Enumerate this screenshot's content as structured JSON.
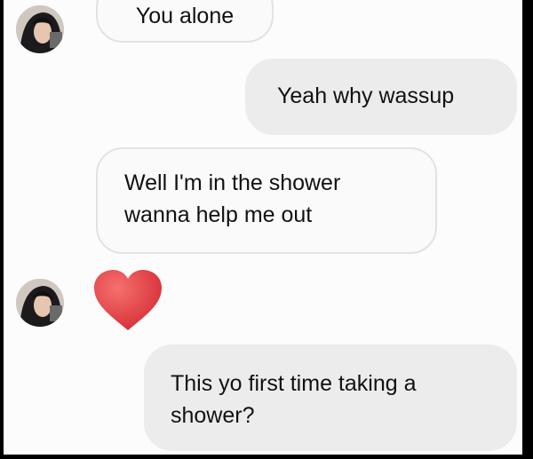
{
  "messages": [
    {
      "sender": "them",
      "text": "You alone"
    },
    {
      "sender": "me",
      "text": "Yeah why wassup"
    },
    {
      "sender": "them",
      "text_lines": [
        "Well I'm in the shower",
        "wanna help me out"
      ]
    },
    {
      "sender": "them",
      "reaction": "heart-emoji"
    },
    {
      "sender": "me",
      "text_lines": [
        "This yo first time taking a",
        "shower?"
      ]
    }
  ],
  "colors": {
    "heart": "#e0383c",
    "outgoing_bubble": "#ececec",
    "incoming_bubble": "#fafafa"
  }
}
